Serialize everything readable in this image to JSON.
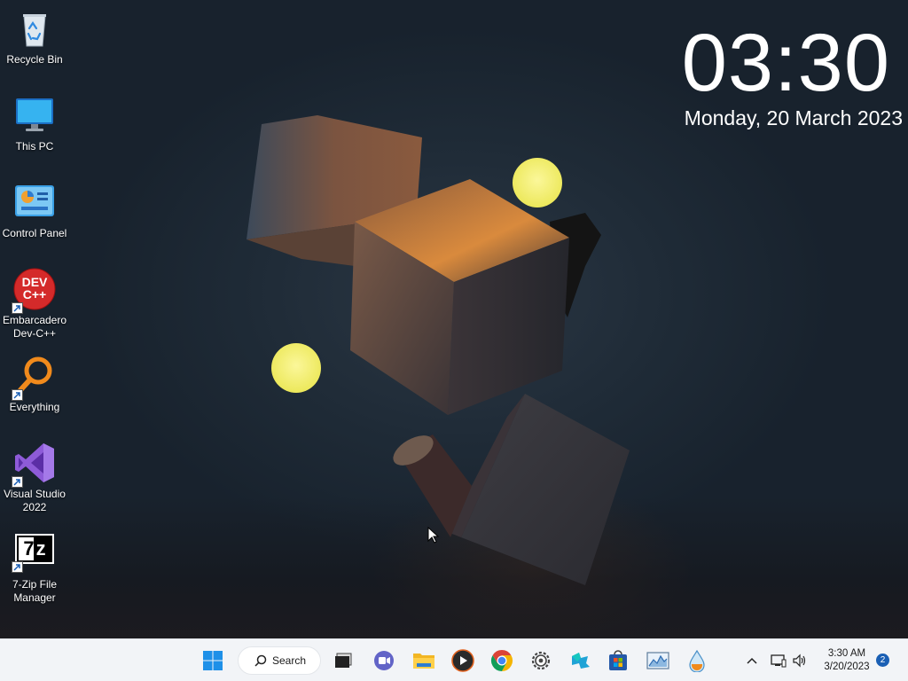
{
  "desktop_icons": [
    {
      "label": "Recycle Bin",
      "icon": "recycle-bin-icon",
      "shortcut": false
    },
    {
      "label": "This PC",
      "icon": "monitor-icon",
      "shortcut": false
    },
    {
      "label": "Control Panel",
      "icon": "control-panel-icon",
      "shortcut": false
    },
    {
      "label": "Embarcadero Dev-C++",
      "icon": "devcpp-icon",
      "shortcut": true,
      "icon_text": "DEV C++"
    },
    {
      "label": "Everything",
      "icon": "magnifier-icon",
      "shortcut": true
    },
    {
      "label": "Visual Studio 2022",
      "icon": "visual-studio-icon",
      "shortcut": true
    },
    {
      "label": "7-Zip File Manager",
      "icon": "7zip-icon",
      "shortcut": true,
      "icon_text": "7z"
    }
  ],
  "clock": {
    "time": "03:30",
    "date": "Monday, 20 March 2023"
  },
  "taskbar": {
    "search_label": "Search",
    "apps": [
      {
        "name": "start-button",
        "icon": "windows-logo-icon"
      },
      {
        "name": "task-view-button",
        "icon": "task-view-icon"
      },
      {
        "name": "teams-button",
        "icon": "video-call-icon"
      },
      {
        "name": "file-explorer-button",
        "icon": "folder-icon"
      },
      {
        "name": "media-player-button",
        "icon": "play-icon"
      },
      {
        "name": "chrome-button",
        "icon": "chrome-icon"
      },
      {
        "name": "settings-app-button",
        "icon": "gear-icon"
      },
      {
        "name": "power-automate-button",
        "icon": "puzzle-icon"
      },
      {
        "name": "store-button",
        "icon": "store-icon"
      },
      {
        "name": "resource-monitor-button",
        "icon": "chart-icon"
      },
      {
        "name": "drop-app-button",
        "icon": "drop-icon"
      }
    ],
    "tray": {
      "time": "3:30 AM",
      "date": "3/20/2023",
      "notification_count": "2"
    }
  },
  "colors": {
    "desktop_bg": "#1d2a37",
    "taskbar_bg": "#f2f4f7",
    "accent": "#1a5fb4",
    "sphere": "#f3ef6a"
  }
}
